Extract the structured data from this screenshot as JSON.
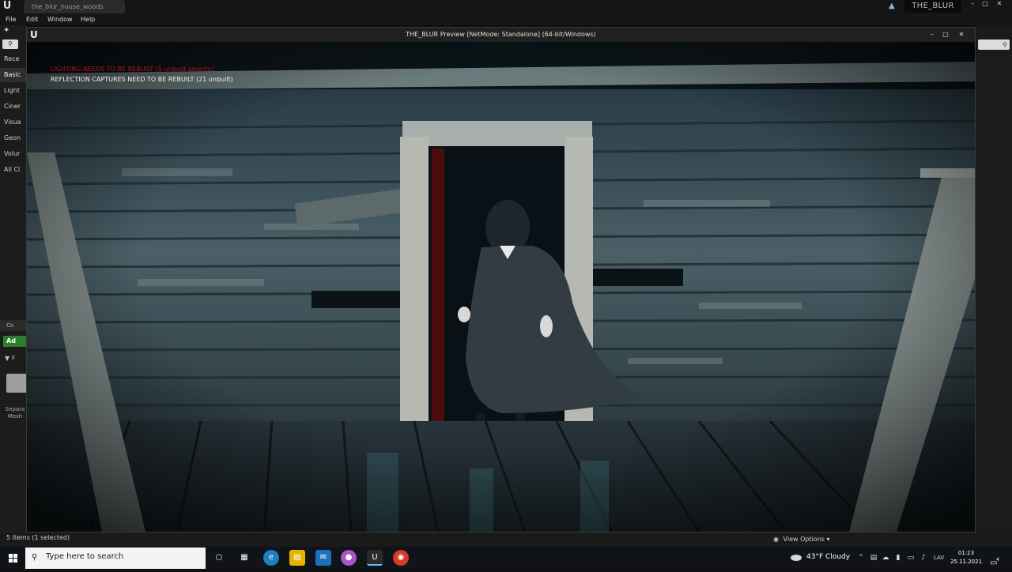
{
  "editor": {
    "tab_title": "the_blur_house_woods",
    "menu": [
      "File",
      "Edit",
      "Window",
      "Help"
    ],
    "project_name": "THE_BLUR",
    "categories": [
      "Rece",
      "Basic",
      "Light",
      "Ciner",
      "Visua",
      "Geon",
      "Volur",
      "All Cl"
    ],
    "content_browser_tab": "Co",
    "add_label": "Ad",
    "filter_label": "F",
    "asset_label": "Separa Mesh"
  },
  "preview": {
    "title": "THE_BLUR Preview [NetMode: Standalone]  (64-bit/Windows)",
    "warning_lighting": "LIGHTING NEEDS TO BE REBUILT (5 unbuilt objects)",
    "warning_reflection": "REFLECTION CAPTURES NEED TO BE REBUILT (21 unbuilt)"
  },
  "status": {
    "items": "5 items (1 selected)",
    "view_options": "View Options"
  },
  "taskbar": {
    "search_placeholder": "Type here to search",
    "weather": "43°F  Cloudy",
    "language": "LAV",
    "time": "01:23",
    "date": "25.11.2021",
    "notification_count": "4"
  },
  "colors": {
    "warning_red": "#b01515",
    "taskbar": "#101418",
    "accent_blue": "#76b9ed"
  }
}
